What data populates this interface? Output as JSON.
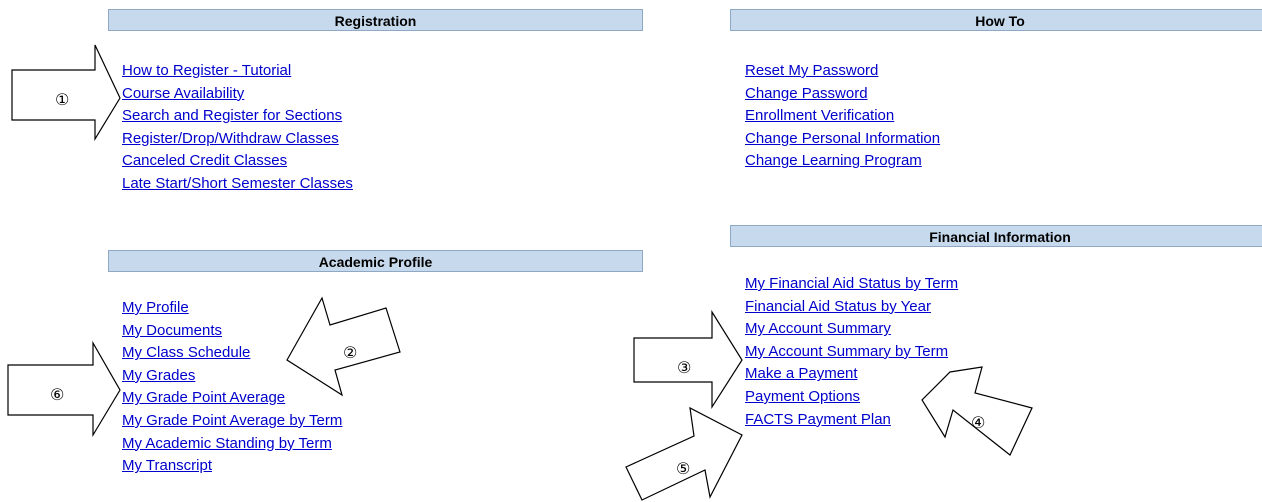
{
  "registration": {
    "header": "Registration",
    "links": [
      "How to Register - Tutorial",
      "Course Availability",
      "Search and Register for Sections",
      "Register/Drop/Withdraw Classes",
      "Canceled Credit Classes",
      "Late Start/Short Semester Classes"
    ]
  },
  "academic_profile": {
    "header": "Academic Profile",
    "links": [
      "My Profile",
      "My Documents",
      "My Class Schedule",
      "My Grades",
      "My Grade Point Average",
      "My Grade Point Average by Term",
      "My Academic Standing by Term",
      "My Transcript"
    ]
  },
  "how_to": {
    "header": "How To",
    "links": [
      "Reset My Password",
      "Change Password",
      "Enrollment Verification",
      "Change Personal Information",
      "Change Learning Program"
    ]
  },
  "financial_information": {
    "header": "Financial Information",
    "links": [
      "My Financial Aid Status by Term",
      "Financial Aid Status by Year",
      "My Account Summary",
      "My Account Summary by Term",
      "Make a Payment",
      "Payment Options",
      "FACTS Payment Plan"
    ]
  },
  "callouts": [
    "①",
    "②",
    "③",
    "④",
    "⑤",
    "⑥"
  ]
}
